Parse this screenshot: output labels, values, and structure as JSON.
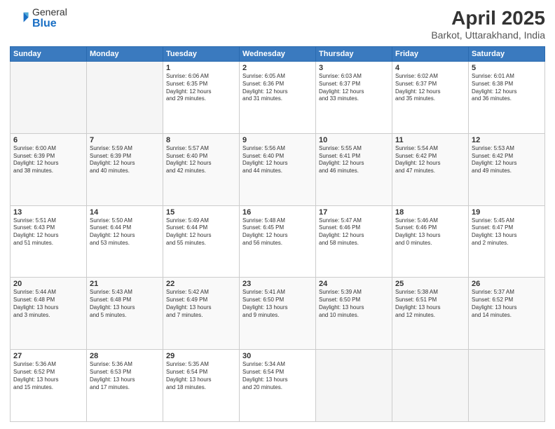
{
  "header": {
    "logo_general": "General",
    "logo_blue": "Blue",
    "title": "April 2025",
    "location": "Barkot, Uttarakhand, India"
  },
  "weekdays": [
    "Sunday",
    "Monday",
    "Tuesday",
    "Wednesday",
    "Thursday",
    "Friday",
    "Saturday"
  ],
  "weeks": [
    [
      {
        "day": "",
        "info": ""
      },
      {
        "day": "",
        "info": ""
      },
      {
        "day": "1",
        "info": "Sunrise: 6:06 AM\nSunset: 6:35 PM\nDaylight: 12 hours\nand 29 minutes."
      },
      {
        "day": "2",
        "info": "Sunrise: 6:05 AM\nSunset: 6:36 PM\nDaylight: 12 hours\nand 31 minutes."
      },
      {
        "day": "3",
        "info": "Sunrise: 6:03 AM\nSunset: 6:37 PM\nDaylight: 12 hours\nand 33 minutes."
      },
      {
        "day": "4",
        "info": "Sunrise: 6:02 AM\nSunset: 6:37 PM\nDaylight: 12 hours\nand 35 minutes."
      },
      {
        "day": "5",
        "info": "Sunrise: 6:01 AM\nSunset: 6:38 PM\nDaylight: 12 hours\nand 36 minutes."
      }
    ],
    [
      {
        "day": "6",
        "info": "Sunrise: 6:00 AM\nSunset: 6:39 PM\nDaylight: 12 hours\nand 38 minutes."
      },
      {
        "day": "7",
        "info": "Sunrise: 5:59 AM\nSunset: 6:39 PM\nDaylight: 12 hours\nand 40 minutes."
      },
      {
        "day": "8",
        "info": "Sunrise: 5:57 AM\nSunset: 6:40 PM\nDaylight: 12 hours\nand 42 minutes."
      },
      {
        "day": "9",
        "info": "Sunrise: 5:56 AM\nSunset: 6:40 PM\nDaylight: 12 hours\nand 44 minutes."
      },
      {
        "day": "10",
        "info": "Sunrise: 5:55 AM\nSunset: 6:41 PM\nDaylight: 12 hours\nand 46 minutes."
      },
      {
        "day": "11",
        "info": "Sunrise: 5:54 AM\nSunset: 6:42 PM\nDaylight: 12 hours\nand 47 minutes."
      },
      {
        "day": "12",
        "info": "Sunrise: 5:53 AM\nSunset: 6:42 PM\nDaylight: 12 hours\nand 49 minutes."
      }
    ],
    [
      {
        "day": "13",
        "info": "Sunrise: 5:51 AM\nSunset: 6:43 PM\nDaylight: 12 hours\nand 51 minutes."
      },
      {
        "day": "14",
        "info": "Sunrise: 5:50 AM\nSunset: 6:44 PM\nDaylight: 12 hours\nand 53 minutes."
      },
      {
        "day": "15",
        "info": "Sunrise: 5:49 AM\nSunset: 6:44 PM\nDaylight: 12 hours\nand 55 minutes."
      },
      {
        "day": "16",
        "info": "Sunrise: 5:48 AM\nSunset: 6:45 PM\nDaylight: 12 hours\nand 56 minutes."
      },
      {
        "day": "17",
        "info": "Sunrise: 5:47 AM\nSunset: 6:46 PM\nDaylight: 12 hours\nand 58 minutes."
      },
      {
        "day": "18",
        "info": "Sunrise: 5:46 AM\nSunset: 6:46 PM\nDaylight: 13 hours\nand 0 minutes."
      },
      {
        "day": "19",
        "info": "Sunrise: 5:45 AM\nSunset: 6:47 PM\nDaylight: 13 hours\nand 2 minutes."
      }
    ],
    [
      {
        "day": "20",
        "info": "Sunrise: 5:44 AM\nSunset: 6:48 PM\nDaylight: 13 hours\nand 3 minutes."
      },
      {
        "day": "21",
        "info": "Sunrise: 5:43 AM\nSunset: 6:48 PM\nDaylight: 13 hours\nand 5 minutes."
      },
      {
        "day": "22",
        "info": "Sunrise: 5:42 AM\nSunset: 6:49 PM\nDaylight: 13 hours\nand 7 minutes."
      },
      {
        "day": "23",
        "info": "Sunrise: 5:41 AM\nSunset: 6:50 PM\nDaylight: 13 hours\nand 9 minutes."
      },
      {
        "day": "24",
        "info": "Sunrise: 5:39 AM\nSunset: 6:50 PM\nDaylight: 13 hours\nand 10 minutes."
      },
      {
        "day": "25",
        "info": "Sunrise: 5:38 AM\nSunset: 6:51 PM\nDaylight: 13 hours\nand 12 minutes."
      },
      {
        "day": "26",
        "info": "Sunrise: 5:37 AM\nSunset: 6:52 PM\nDaylight: 13 hours\nand 14 minutes."
      }
    ],
    [
      {
        "day": "27",
        "info": "Sunrise: 5:36 AM\nSunset: 6:52 PM\nDaylight: 13 hours\nand 15 minutes."
      },
      {
        "day": "28",
        "info": "Sunrise: 5:36 AM\nSunset: 6:53 PM\nDaylight: 13 hours\nand 17 minutes."
      },
      {
        "day": "29",
        "info": "Sunrise: 5:35 AM\nSunset: 6:54 PM\nDaylight: 13 hours\nand 18 minutes."
      },
      {
        "day": "30",
        "info": "Sunrise: 5:34 AM\nSunset: 6:54 PM\nDaylight: 13 hours\nand 20 minutes."
      },
      {
        "day": "",
        "info": ""
      },
      {
        "day": "",
        "info": ""
      },
      {
        "day": "",
        "info": ""
      }
    ]
  ]
}
